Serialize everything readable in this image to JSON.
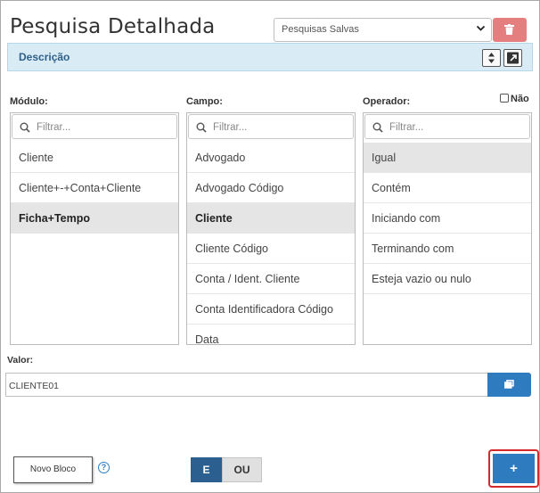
{
  "title": "Pesquisa Detalhada",
  "saved_searches": {
    "selected": "Pesquisas Salvas"
  },
  "description_bar": {
    "label": "Descrição"
  },
  "nao_label": "Não",
  "columns": {
    "modulo": {
      "label": "Módulo:",
      "filter_placeholder": "Filtrar...",
      "items": [
        "Cliente",
        "Cliente+-+Conta+Cliente",
        "Ficha+Tempo"
      ],
      "selected_index": 2
    },
    "campo": {
      "label": "Campo:",
      "filter_placeholder": "Filtrar...",
      "items": [
        "Advogado",
        "Advogado Código",
        "Cliente",
        "Cliente Código",
        "Conta / Ident. Cliente",
        "Conta Identificadora Código",
        "Data"
      ],
      "selected_index": 2
    },
    "operador": {
      "label": "Operador:",
      "filter_placeholder": "Filtrar...",
      "items": [
        "Igual",
        "Contém",
        "Iniciando com",
        "Terminando com",
        "Esteja vazio ou nulo"
      ],
      "selected_index": 0
    }
  },
  "valor": {
    "label": "Valor:",
    "value": "CLIENTE01"
  },
  "footer": {
    "novo_bloco": "Novo Bloco",
    "help": "?",
    "and_label": "E",
    "or_label": "OU",
    "add_label": "+"
  },
  "colors": {
    "primary": "#2f7bbf",
    "dark_primary": "#2a5f8f",
    "danger": "#e57e7e",
    "highlight": "#d62a2a",
    "desc_bg": "#d9ecf5"
  }
}
